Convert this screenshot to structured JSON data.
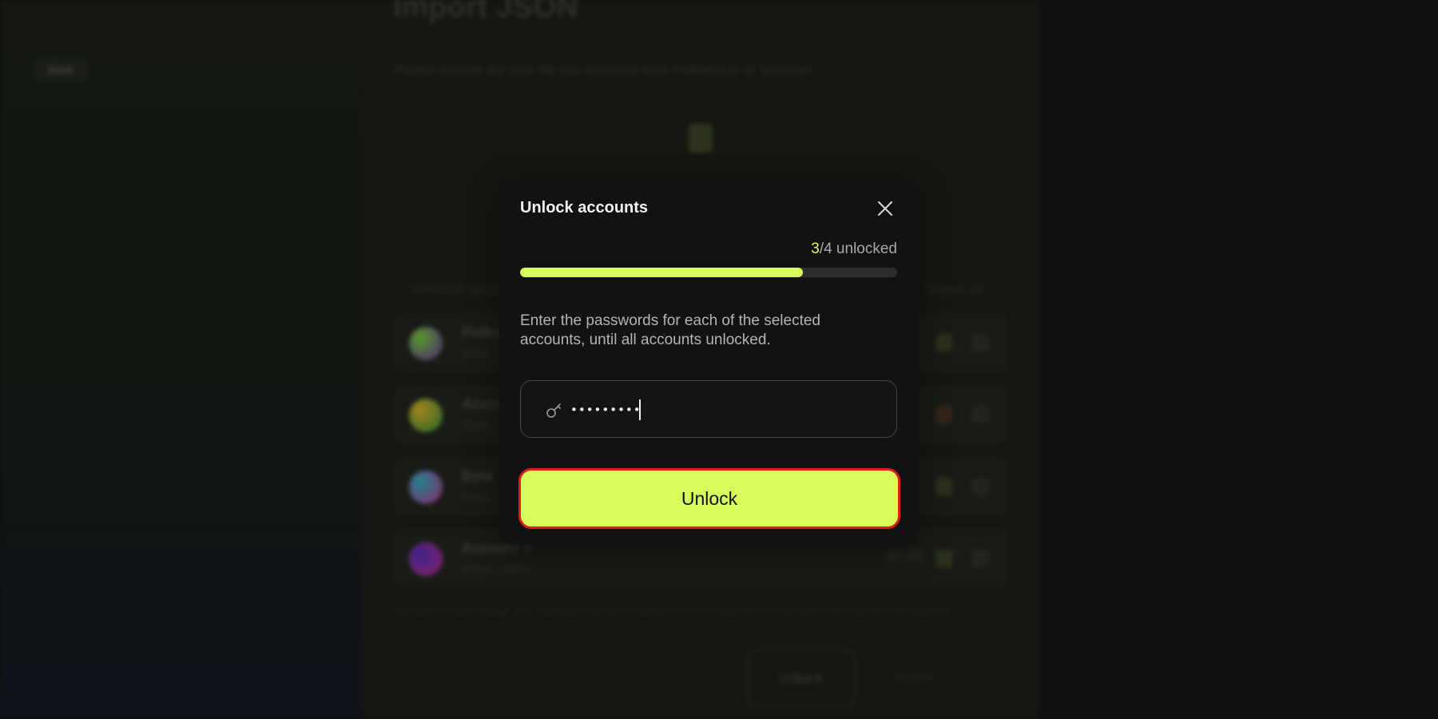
{
  "background": {
    "back_label": "Back",
    "page_title": "Import JSON",
    "page_subtitle": "Please choose the json file you exported from Polkadot.js or Talisman",
    "selected_label": "Selected accounts",
    "select_all_label": "Select all",
    "accounts": [
      {
        "name": "Polkadot",
        "address": "5de6...",
        "avatar_color": "#6fbf3a"
      },
      {
        "name": "Account",
        "address": "5Ha6...",
        "avatar_color": "#c9a12a"
      },
      {
        "name": "Beta",
        "address": "5Gk9...",
        "avatar_color": "#c2338f"
      },
      {
        "name": "Account 2",
        "address": "5FhJ3...Aamo",
        "avatar_color": "#5a2fc0",
        "balance": "$0.00"
      }
    ],
    "note": "During the import stage, the Talisman extension may become unresponsive if many accounts are being imported",
    "unlock_label": "Unlock",
    "import_label": "Import"
  },
  "modal": {
    "title": "Unlock accounts",
    "close_icon": "close-icon",
    "progress": {
      "unlocked": "3",
      "total_text": "/4 unlocked",
      "fraction": 0.75
    },
    "instructions": "Enter the passwords for each of the selected accounts, until all accounts unlocked.",
    "password": {
      "icon": "key-icon",
      "value": "•••••••••"
    },
    "unlock_button": "Unlock"
  },
  "colors": {
    "accent": "#d6fb5a",
    "focus_outline": "#e01b1b",
    "modal_bg": "#121212"
  }
}
